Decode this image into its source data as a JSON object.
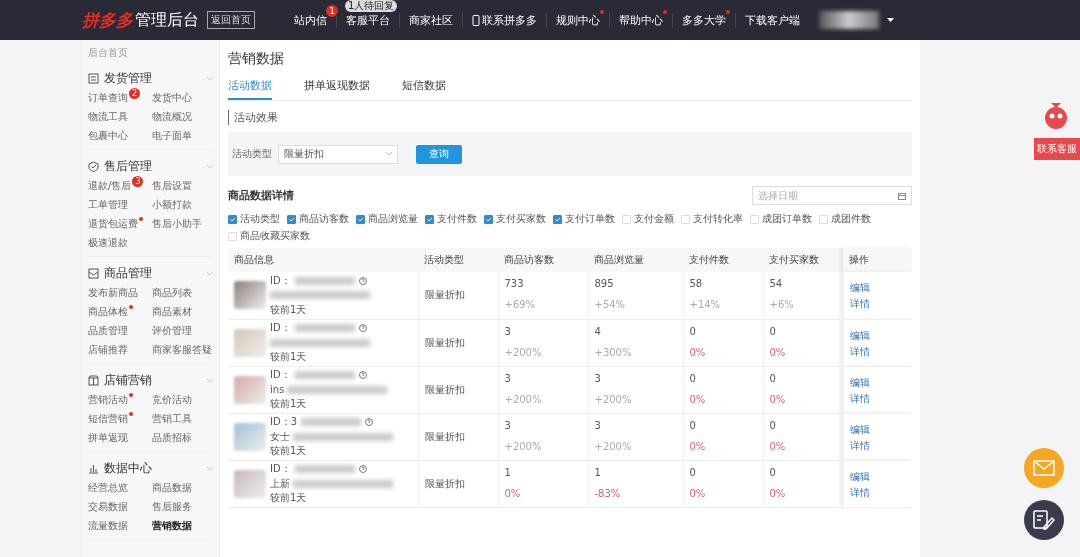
{
  "topbar": {
    "logo": "拼多多",
    "title": "管理后台",
    "home_button": "返回首页",
    "nav": [
      {
        "label": "站内信",
        "badge": "1",
        "dot": false,
        "kind": "text"
      },
      {
        "label": "客服平台",
        "bubble": "1人待回复",
        "dot": false,
        "kind": "text"
      },
      {
        "label": "商家社区",
        "dot": false,
        "kind": "text"
      },
      {
        "label": "联系拼多多",
        "dot": false,
        "kind": "phone"
      },
      {
        "label": "规则中心",
        "dot": true,
        "kind": "text"
      },
      {
        "label": "帮助中心",
        "dot": true,
        "kind": "text"
      },
      {
        "label": "多多大学",
        "dot": true,
        "kind": "text"
      },
      {
        "label": "下载客户端",
        "dot": false,
        "kind": "text"
      }
    ]
  },
  "sidebar": {
    "home": "后台首页",
    "sections": [
      {
        "title": "发货管理",
        "expanded": true,
        "items": [
          {
            "label": "订单查询",
            "badge": "2",
            "dot": false,
            "selected": false
          },
          {
            "label": "发货中心",
            "dot": false,
            "selected": false
          },
          {
            "label": "物流工具",
            "dot": false,
            "selected": false
          },
          {
            "label": "物流概况",
            "dot": false,
            "selected": false
          },
          {
            "label": "包裹中心",
            "dot": false,
            "selected": false
          },
          {
            "label": "电子面单",
            "dot": false,
            "selected": false
          }
        ]
      },
      {
        "title": "售后管理",
        "expanded": true,
        "items": [
          {
            "label": "退款/售后",
            "badge": "3",
            "dot": false,
            "selected": false
          },
          {
            "label": "售后设置",
            "dot": false,
            "selected": false
          },
          {
            "label": "工单管理",
            "dot": false,
            "selected": false
          },
          {
            "label": "小额打款",
            "dot": false,
            "selected": false
          },
          {
            "label": "退货包运费",
            "dot": true,
            "selected": false
          },
          {
            "label": "售后小助手",
            "dot": false,
            "selected": false
          },
          {
            "label": "极速退款",
            "dot": false,
            "selected": false
          }
        ]
      },
      {
        "title": "商品管理",
        "expanded": true,
        "items": [
          {
            "label": "发布新商品",
            "dot": false,
            "selected": false
          },
          {
            "label": "商品列表",
            "dot": false,
            "selected": false
          },
          {
            "label": "商品体检",
            "dot": true,
            "selected": false
          },
          {
            "label": "商品素材",
            "dot": false,
            "selected": false
          },
          {
            "label": "品质管理",
            "dot": false,
            "selected": false
          },
          {
            "label": "评价管理",
            "dot": false,
            "selected": false
          },
          {
            "label": "店铺推荐",
            "dot": false,
            "selected": false
          },
          {
            "label": "商家客服答疑",
            "dot": false,
            "selected": false
          }
        ]
      },
      {
        "title": "店铺营销",
        "expanded": true,
        "items": [
          {
            "label": "营销活动",
            "dot": true,
            "selected": false
          },
          {
            "label": "竞价活动",
            "dot": false,
            "selected": false
          },
          {
            "label": "短信营销",
            "dot": true,
            "selected": false
          },
          {
            "label": "营销工具",
            "dot": false,
            "selected": false
          },
          {
            "label": "拼单返现",
            "dot": false,
            "selected": false
          },
          {
            "label": "品质招标",
            "dot": false,
            "selected": false
          }
        ]
      },
      {
        "title": "数据中心",
        "expanded": true,
        "items": [
          {
            "label": "经营总览",
            "dot": false,
            "selected": false
          },
          {
            "label": "商品数据",
            "dot": false,
            "selected": false
          },
          {
            "label": "交易数据",
            "dot": false,
            "selected": false
          },
          {
            "label": "售后服务",
            "dot": false,
            "selected": false
          },
          {
            "label": "流量数据",
            "dot": false,
            "selected": false
          },
          {
            "label": "营销数据",
            "dot": false,
            "selected": true
          }
        ]
      }
    ]
  },
  "main": {
    "title": "营销数据",
    "tabs": [
      {
        "label": "活动数据",
        "selected": true
      },
      {
        "label": "拼单返现数据",
        "selected": false
      },
      {
        "label": "短信数据",
        "selected": false
      }
    ],
    "section_title": "活动效果",
    "filter": {
      "label": "活动类型",
      "value": "限量折扣",
      "button": "查询"
    },
    "detail_title": "商品数据详情",
    "date_placeholder": "选择日期",
    "columns_options": [
      {
        "label": "活动类型",
        "checked": true
      },
      {
        "label": "商品访客数",
        "checked": true
      },
      {
        "label": "商品浏览量",
        "checked": true
      },
      {
        "label": "支付件数",
        "checked": true
      },
      {
        "label": "支付买家数",
        "checked": true
      },
      {
        "label": "支付订单数",
        "checked": true
      },
      {
        "label": "支付金额",
        "checked": false
      },
      {
        "label": "支付转化率",
        "checked": false
      },
      {
        "label": "成团订单数",
        "checked": false
      },
      {
        "label": "成团件数",
        "checked": false
      },
      {
        "label": "商品收藏买家数",
        "checked": false
      }
    ],
    "table": {
      "columns": [
        "商品信息",
        "活动类型",
        "商品访客数",
        "商品浏览量",
        "支付件数",
        "支付买家数",
        "操作"
      ],
      "rows": [
        {
          "cells": [
            {
              "id_label": "ID：",
              "age": "较前1天"
            },
            {
              "value": "限量折扣"
            },
            {
              "value": "733",
              "delta": "+69%",
              "kind": "neutral"
            },
            {
              "value": "895",
              "delta": "+54%",
              "kind": "neutral"
            },
            {
              "value": "58",
              "delta": "+14%",
              "kind": "neutral"
            },
            {
              "value": "54",
              "delta": "+6%",
              "kind": "neutral"
            },
            {
              "actions": [
                "编辑",
                "详情"
              ]
            }
          ]
        },
        {
          "cells": [
            {
              "id_label": "ID：",
              "age": "较前1天"
            },
            {
              "value": "限量折扣"
            },
            {
              "value": "3",
              "delta": "+200%",
              "kind": "neutral"
            },
            {
              "value": "4",
              "delta": "+300%",
              "kind": "neutral"
            },
            {
              "value": "0",
              "delta": "0%",
              "kind": "alert"
            },
            {
              "value": "0",
              "delta": "0%",
              "kind": "alert"
            },
            {
              "actions": [
                "编辑",
                "详情"
              ]
            }
          ]
        },
        {
          "cells": [
            {
              "id_label": "ID：",
              "name": "ins",
              "age": "较前1天"
            },
            {
              "value": "限量折扣"
            },
            {
              "value": "3",
              "delta": "+200%",
              "kind": "neutral"
            },
            {
              "value": "3",
              "delta": "+200%",
              "kind": "neutral"
            },
            {
              "value": "0",
              "delta": "0%",
              "kind": "alert"
            },
            {
              "value": "0",
              "delta": "0%",
              "kind": "alert"
            },
            {
              "actions": [
                "编辑",
                "详情"
              ]
            }
          ]
        },
        {
          "cells": [
            {
              "id_label": "ID：3",
              "name": "女士",
              "age": "较前1天"
            },
            {
              "value": "限量折扣"
            },
            {
              "value": "3",
              "delta": "+200%",
              "kind": "neutral"
            },
            {
              "value": "3",
              "delta": "+200%",
              "kind": "neutral"
            },
            {
              "value": "0",
              "delta": "0%",
              "kind": "alert"
            },
            {
              "value": "0",
              "delta": "0%",
              "kind": "alert"
            },
            {
              "actions": [
                "编辑",
                "详情"
              ]
            }
          ]
        },
        {
          "cells": [
            {
              "id_label": "ID：",
              "name": "上新",
              "age": "较前1天"
            },
            {
              "value": "限量折扣"
            },
            {
              "value": "1",
              "delta": "0%",
              "kind": "alert"
            },
            {
              "value": "1",
              "delta": "-83%",
              "kind": "alert"
            },
            {
              "value": "0",
              "delta": "0%",
              "kind": "alert"
            },
            {
              "value": "0",
              "delta": "0%",
              "kind": "alert"
            },
            {
              "actions": [
                "编辑",
                "详情"
              ]
            }
          ]
        }
      ]
    }
  },
  "float": {
    "service": "联系客服"
  }
}
